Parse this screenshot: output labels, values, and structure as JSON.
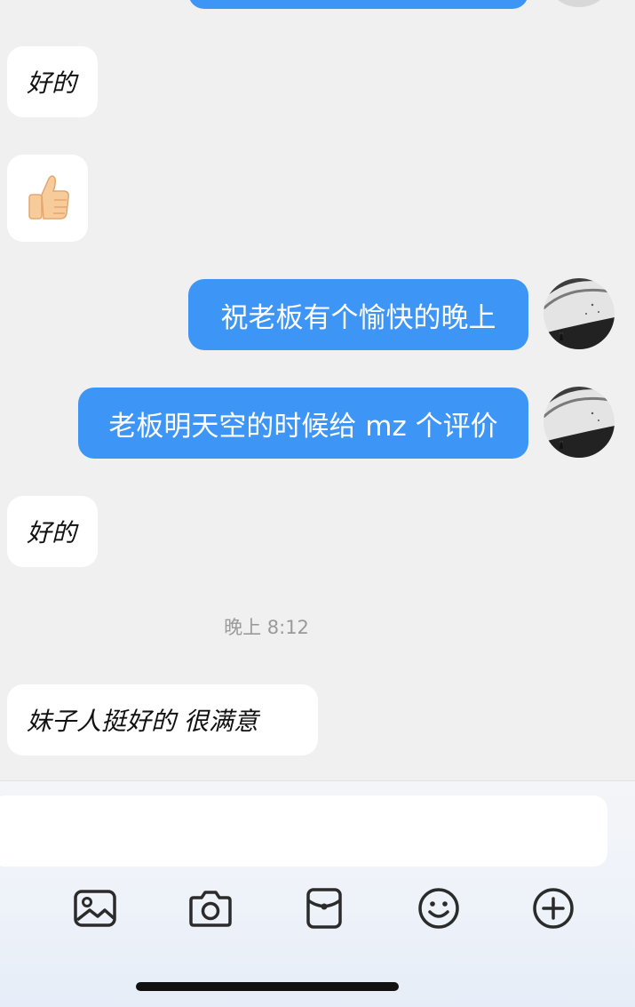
{
  "messages": {
    "m1": "好的",
    "m2_emoji": "👍",
    "m3": "祝老板有个愉快的晚上",
    "m4": "老板明天空的时候给 mz 个评价",
    "m5": "好的",
    "time": "晚上 8:12",
    "m6": "妹子人挺好的 很满意"
  },
  "composer": {
    "input_value": ""
  },
  "toolbar": {
    "icons": [
      "image-icon",
      "camera-icon",
      "red-packet-icon",
      "emoji-icon",
      "plus-icon"
    ]
  },
  "colors": {
    "chat_bg": "#f0f0f0",
    "outgoing_bubble": "#3d95f5",
    "incoming_bubble": "#ffffff"
  }
}
